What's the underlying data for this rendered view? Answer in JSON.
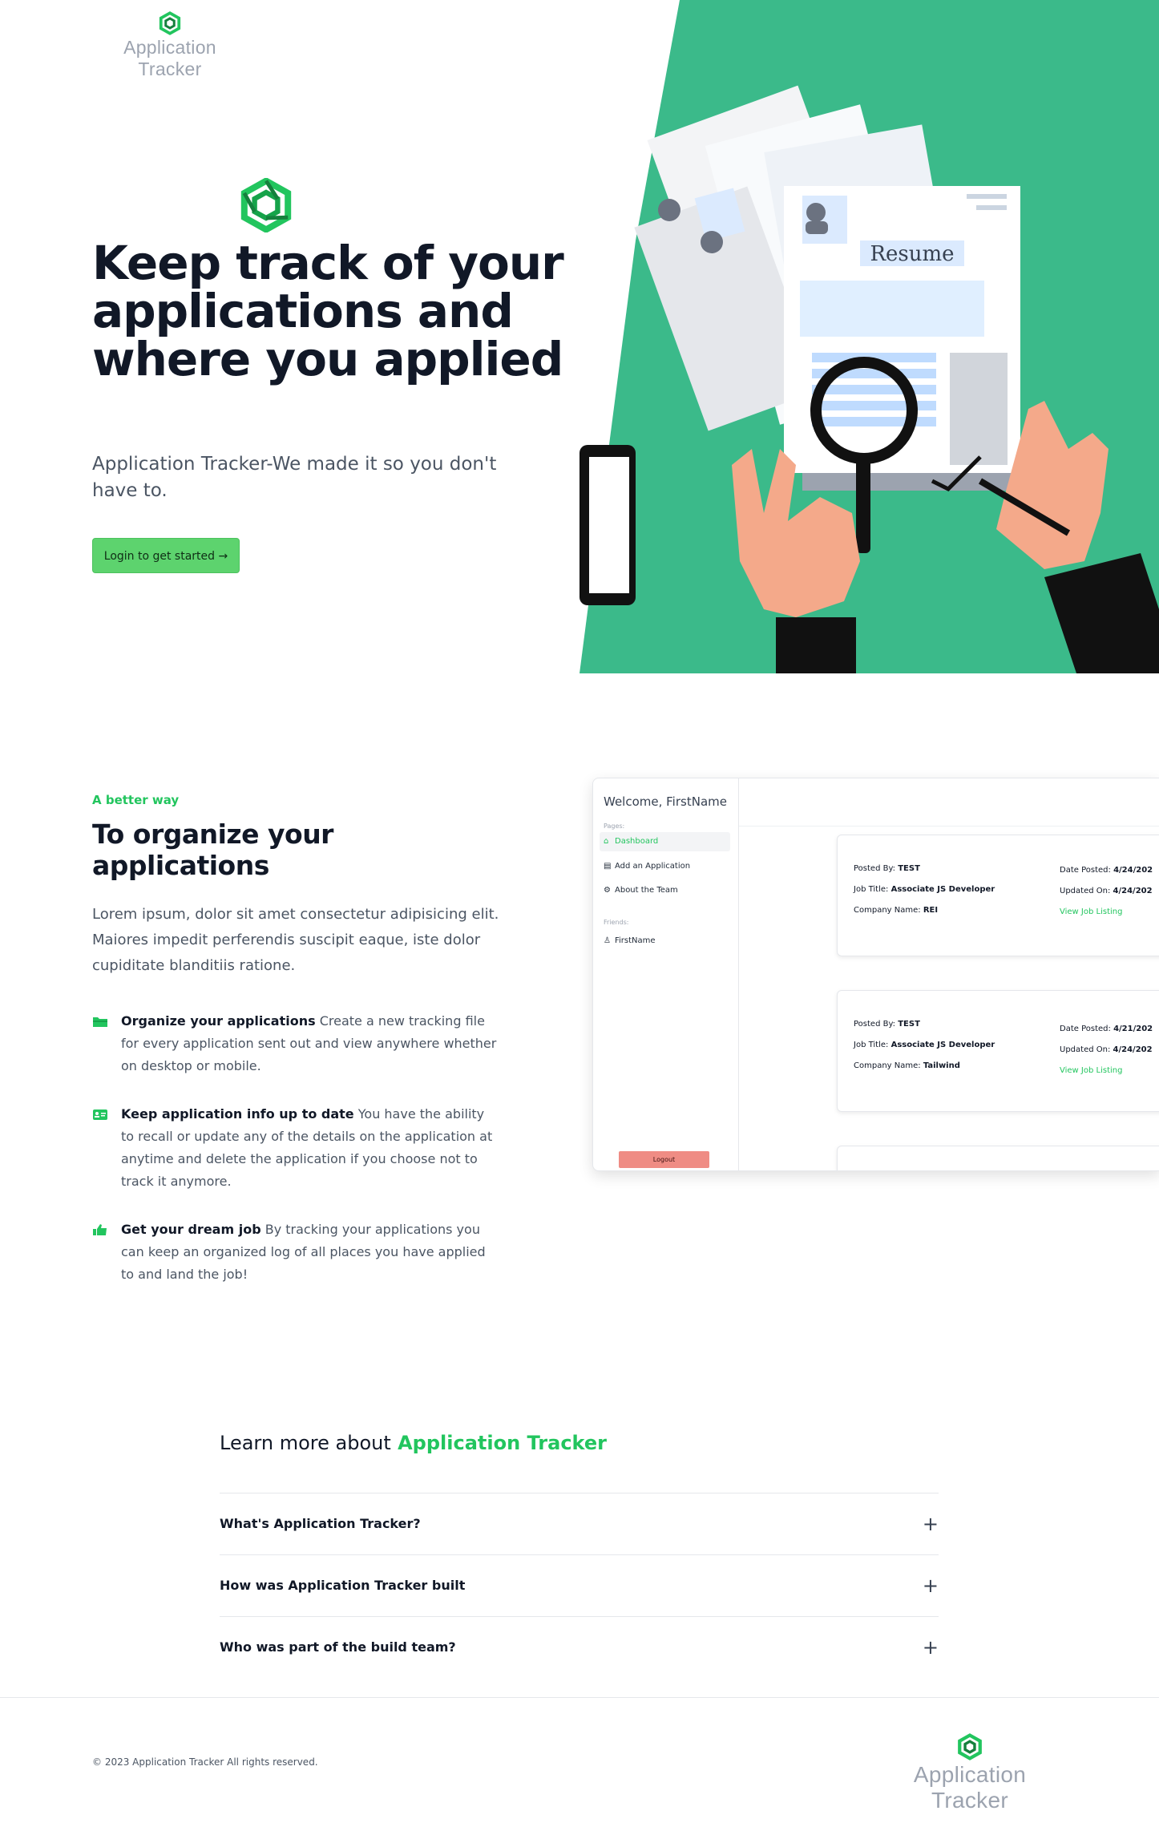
{
  "header": {
    "brand_name": "Application Tracker"
  },
  "hero": {
    "title": "Keep track of your applications and where you applied",
    "subtitle": "Application Tracker-We made it so you don't have to.",
    "cta_label": "Login to get started →",
    "illustration_text": "Resume"
  },
  "features": {
    "eyebrow": "A better way",
    "title": "To organize your applications",
    "description": "Lorem ipsum, dolor sit amet consectetur adipisicing elit. Maiores impedit perferendis suscipit eaque, iste dolor cupiditate blanditiis ratione.",
    "items": [
      {
        "icon": "folder-icon",
        "title": "Organize your applications",
        "text": "Create a new tracking file for every application sent out and view anywhere whether on desktop or mobile."
      },
      {
        "icon": "id-card-icon",
        "title": "Keep application info up to date",
        "text": "You have the ability to recall or update any of the details on the application at anytime and delete the application if you choose not to track it anymore."
      },
      {
        "icon": "thumbs-up-icon",
        "title": "Get your dream job",
        "text": "By tracking your applications you can keep an organized log of all places you have applied to and land the job!"
      }
    ]
  },
  "dashboard_preview": {
    "welcome": "Welcome, FirstName",
    "pages_label": "Pages:",
    "nav": [
      "Dashboard",
      "Add an Application",
      "About the Team"
    ],
    "friends_label": "Friends:",
    "friend": "FirstName",
    "logout": "Logout",
    "cards": [
      {
        "posted_by_label": "Posted By:",
        "posted_by": "TEST",
        "job_title_label": "Job Title:",
        "job_title": "Associate JS Developer",
        "company_label": "Company Name:",
        "company": "REI",
        "date_posted_label": "Date Posted:",
        "date_posted": "4/24/202",
        "updated_label": "Updated On:",
        "updated": "4/24/202",
        "link": "View Job Listing"
      },
      {
        "posted_by_label": "Posted By:",
        "posted_by": "TEST",
        "job_title_label": "Job Title:",
        "job_title": "Associate JS Developer",
        "company_label": "Company Name:",
        "company": "Tailwind",
        "date_posted_label": "Date Posted:",
        "date_posted": "4/21/202",
        "updated_label": "Updated On:",
        "updated": "4/24/202",
        "link": "View Job Listing"
      }
    ]
  },
  "faq": {
    "heading_prefix": "Learn more about",
    "heading_brand": "Application Tracker",
    "questions": [
      "What's Application Tracker?",
      "How was Application Tracker built",
      "Who was part of the build team?"
    ]
  },
  "footer": {
    "copyright": "© 2023 Application Tracker All rights reserved.",
    "brand_name": "Application Tracker"
  },
  "colors": {
    "accent": "#22c55e",
    "hero_green": "#3bba8a",
    "button": "#5dd36e",
    "logout": "#ef8c84"
  }
}
